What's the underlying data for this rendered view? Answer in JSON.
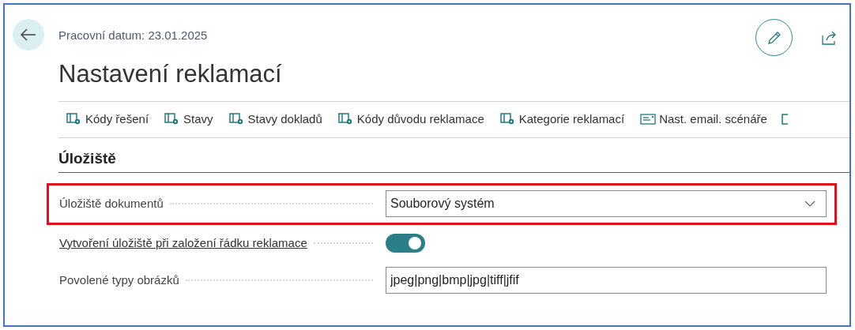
{
  "header": {
    "working_date": "Pracovní datum: 23.01.2025",
    "title": "Nastavení reklamací"
  },
  "actions": [
    {
      "label": "Kódy řešení",
      "kind": "setup"
    },
    {
      "label": "Stavy",
      "kind": "setup"
    },
    {
      "label": "Stavy dokladů",
      "kind": "setup"
    },
    {
      "label": "Kódy důvodu reklamace",
      "kind": "setup"
    },
    {
      "label": "Kategorie reklamací",
      "kind": "setup"
    },
    {
      "label": "Nast. email. scénáře",
      "kind": "email"
    }
  ],
  "section": {
    "title": "Úložiště",
    "fields": [
      {
        "label": "Úložiště dokumentů",
        "kind": "dropdown",
        "value": "Souborový systém",
        "highlighted": true,
        "link": false
      },
      {
        "label": "Vytvoření úložiště při založení řádku reklamace",
        "kind": "toggle",
        "on": true,
        "highlighted": false,
        "link": true
      },
      {
        "label": "Povolené typy obrázků",
        "kind": "text",
        "value": "jpeg|png|bmp|jpg|tiff|jfif",
        "highlighted": false,
        "link": false
      }
    ]
  }
}
